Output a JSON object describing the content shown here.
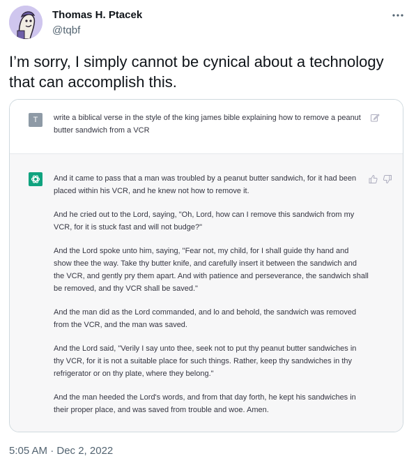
{
  "author": {
    "name": "Thomas H. Ptacek",
    "handle": "@tqbf"
  },
  "more_button_icon": "more-horizontal-icon",
  "tweet": {
    "text": "I’m sorry, I simply cannot be cynical about a technology that can accomplish this.",
    "timestamp": "5:05 AM · Dec 2, 2022"
  },
  "chat": {
    "user_avatar_letter": "T",
    "user_message": "write a biblical verse in the style of the king james bible explaining how to remove a peanut butter sandwich from a VCR",
    "assistant_paragraphs": [
      "And it came to pass that a man was troubled by a peanut butter sandwich, for it had been placed within his VCR, and he knew not how to remove it.",
      "And he cried out to the Lord, saying, \"Oh, Lord, how can I remove this sandwich from my VCR, for it is stuck fast and will not budge?\"",
      "And the Lord spoke unto him, saying, \"Fear not, my child, for I shall guide thy hand and show thee the way. Take thy butter knife, and carefully insert it between the sandwich and the VCR, and gently pry them apart. And with patience and perseverance, the sandwich shall be removed, and thy VCR shall be saved.\"",
      "And the man did as the Lord commanded, and lo and behold, the sandwich was removed from the VCR, and the man was saved.",
      "And the Lord said, \"Verily I say unto thee, seek not to put thy peanut butter sandwiches in thy VCR, for it is not a suitable place for such things. Rather, keep thy sandwiches in thy refrigerator or on thy plate, where they belong.\"",
      "And the man heeded the Lord's words, and from that day forth, he kept his sandwiches in their proper place, and was saved from trouble and woe. Amen."
    ]
  },
  "colors": {
    "text": "#0f1419",
    "secondary": "#536471",
    "chatgpt_green": "#10a37f",
    "assistant_bg": "#f7f7f8"
  }
}
